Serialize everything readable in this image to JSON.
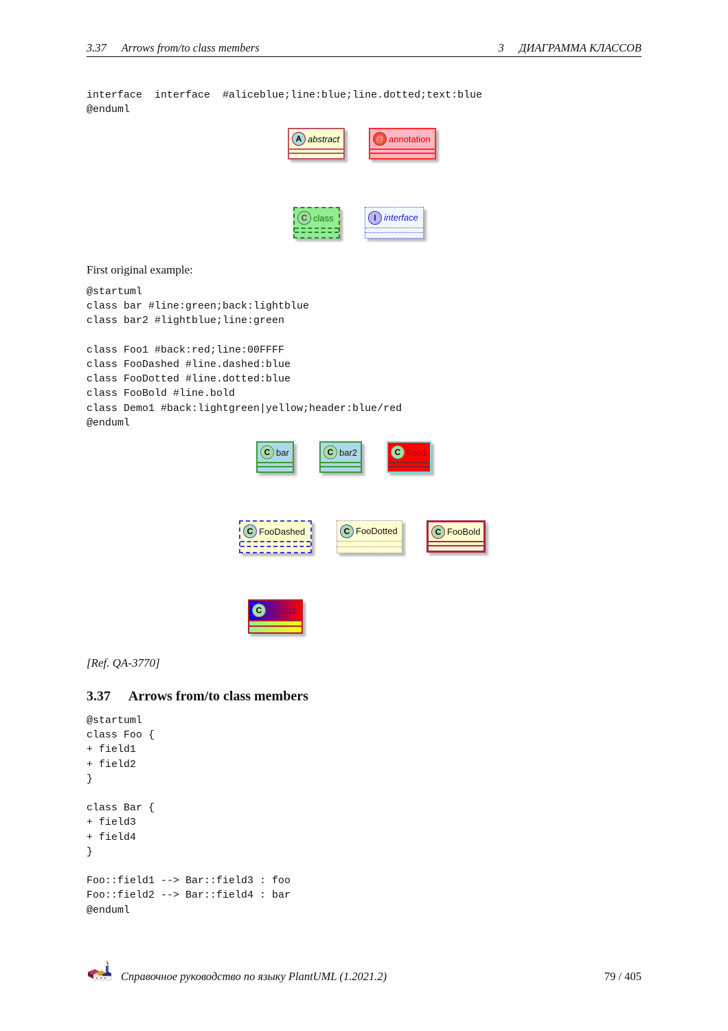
{
  "header": {
    "section_number": "3.37",
    "section_title": "Arrows from/to class members",
    "chapter_number": "3",
    "chapter_title": "ДИАГРАММА КЛАССОВ"
  },
  "top_code": [
    "interface  interface  #aliceblue;line:blue;line.dotted;text:blue",
    "@enduml"
  ],
  "diagram1": {
    "classes": [
      {
        "name": "abstract",
        "badge": "A",
        "style": "abstract",
        "back": "#fefece",
        "line": "#a80036"
      },
      {
        "name": "annotation",
        "badge": "@",
        "style": "annotation",
        "back": "#ffb6c1",
        "line": "#ff0000"
      },
      {
        "name": "class",
        "badge": "C",
        "style": "dashed",
        "back": "#90ee90",
        "line": "#006400"
      },
      {
        "name": "interface",
        "badge": "I",
        "style": "dotted",
        "back": "#f0f8ff",
        "line": "#0000ff"
      }
    ]
  },
  "intro_text": "First original example:",
  "code2": [
    "@startuml",
    "class bar #line:green;back:lightblue",
    "class bar2 #lightblue;line:green",
    "",
    "class Foo1 #back:red;line:00FFFF",
    "class FooDashed #line.dashed:blue",
    "class FooDotted #line.dotted:blue",
    "class FooBold #line.bold",
    "class Demo1 #back:lightgreen|yellow;header:blue/red",
    "@enduml"
  ],
  "diagram2": {
    "classes": [
      {
        "name": "bar",
        "badge": "C"
      },
      {
        "name": "bar2",
        "badge": "C"
      },
      {
        "name": "Foo1",
        "badge": "C"
      },
      {
        "name": "FooDashed",
        "badge": "C"
      },
      {
        "name": "FooDotted",
        "badge": "C"
      },
      {
        "name": "FooBold",
        "badge": "C"
      },
      {
        "name": "Demo1",
        "badge": "C"
      }
    ],
    "colors": {
      "lightblue": "#add8e6",
      "green": "#228b22",
      "red": "#ff0000",
      "cyan": "#00ffff",
      "blue": "#0000ff",
      "yellow_back": "#fefece",
      "bold_line": "#a80036"
    }
  },
  "ref": "[Ref. QA-3770]",
  "section": {
    "number": "3.37",
    "title": "Arrows from/to class members"
  },
  "code3": [
    "@startuml",
    "class Foo {",
    "+ field1",
    "+ field2",
    "}",
    "",
    "class Bar {",
    "+ field3",
    "+ field4",
    "}",
    "",
    "Foo::field1 --> Bar::field3 : foo",
    "Foo::field2 --> Bar::field4 : bar",
    "@enduml"
  ],
  "footer": {
    "title": "Справочное руководство по языку PlantUML (1.2021.2)",
    "page": "79 / 405",
    "logo_icon": "plantuml-logo-icon"
  }
}
